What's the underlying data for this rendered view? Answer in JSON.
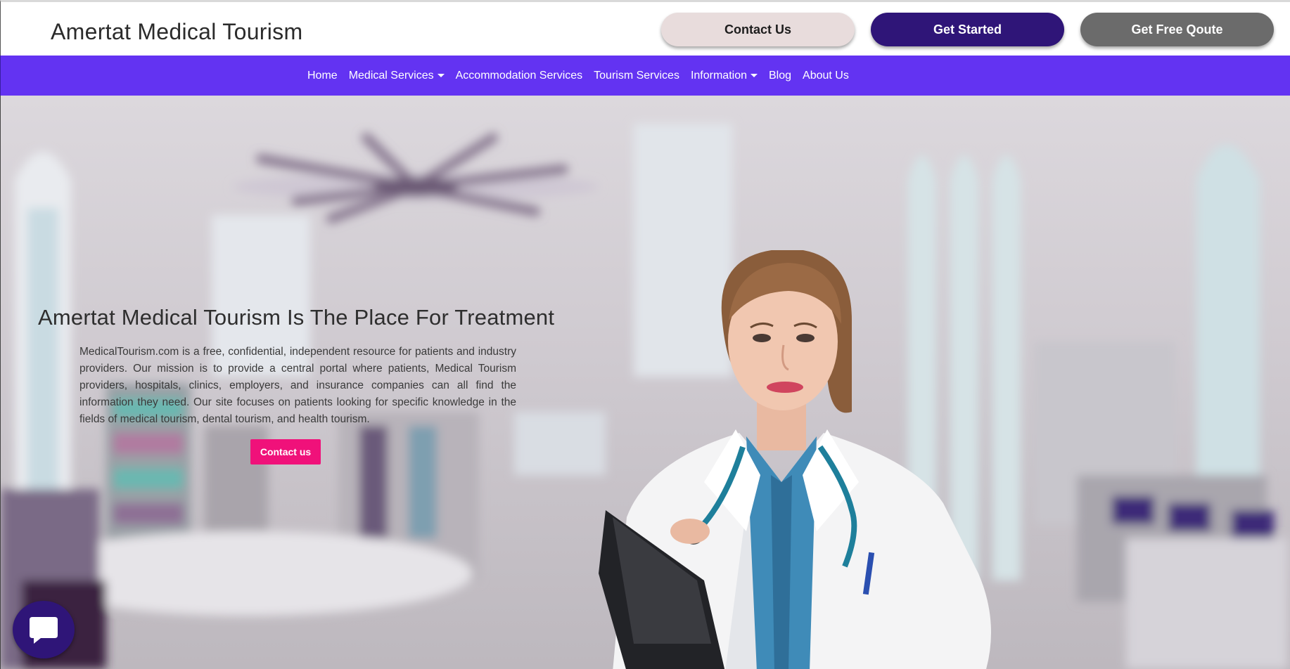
{
  "header": {
    "brand": "Amertat Medical Tourism",
    "buttons": {
      "contact": "Contact Us",
      "get_started": "Get Started",
      "free_quote": "Get Free Qoute"
    }
  },
  "nav": {
    "items": [
      {
        "label": "Home",
        "dropdown": false
      },
      {
        "label": "Medical Services",
        "dropdown": true
      },
      {
        "label": "Accommodation Services",
        "dropdown": false
      },
      {
        "label": "Tourism Services",
        "dropdown": false
      },
      {
        "label": "Information",
        "dropdown": true
      },
      {
        "label": "Blog",
        "dropdown": false
      },
      {
        "label": "About Us",
        "dropdown": false
      }
    ]
  },
  "hero": {
    "title": "Amertat Medical Tourism Is The Place For Treatment",
    "description": "MedicalTourism.com is a free, confidential, independent resource for patients and industry providers. Our mission is to provide a central portal where patients, Medical Tourism providers, hospitals, clinics, employers, and insurance companies can all find the information they need. Our site focuses on patients looking for specific knowledge in the fields of medical tourism, dental tourism, and health tourism.",
    "cta": "Contact us",
    "image": "doctor-with-clipboard-and-stethoscope"
  },
  "chat": {
    "icon": "chat-bubble-icon"
  },
  "colors": {
    "nav_bg": "#6333f2",
    "primary_dark": "#2f1578",
    "cta_pink": "#f0117a",
    "contact_btn_bg": "#e8dcdc",
    "quote_btn_bg": "#6b6b6b"
  }
}
